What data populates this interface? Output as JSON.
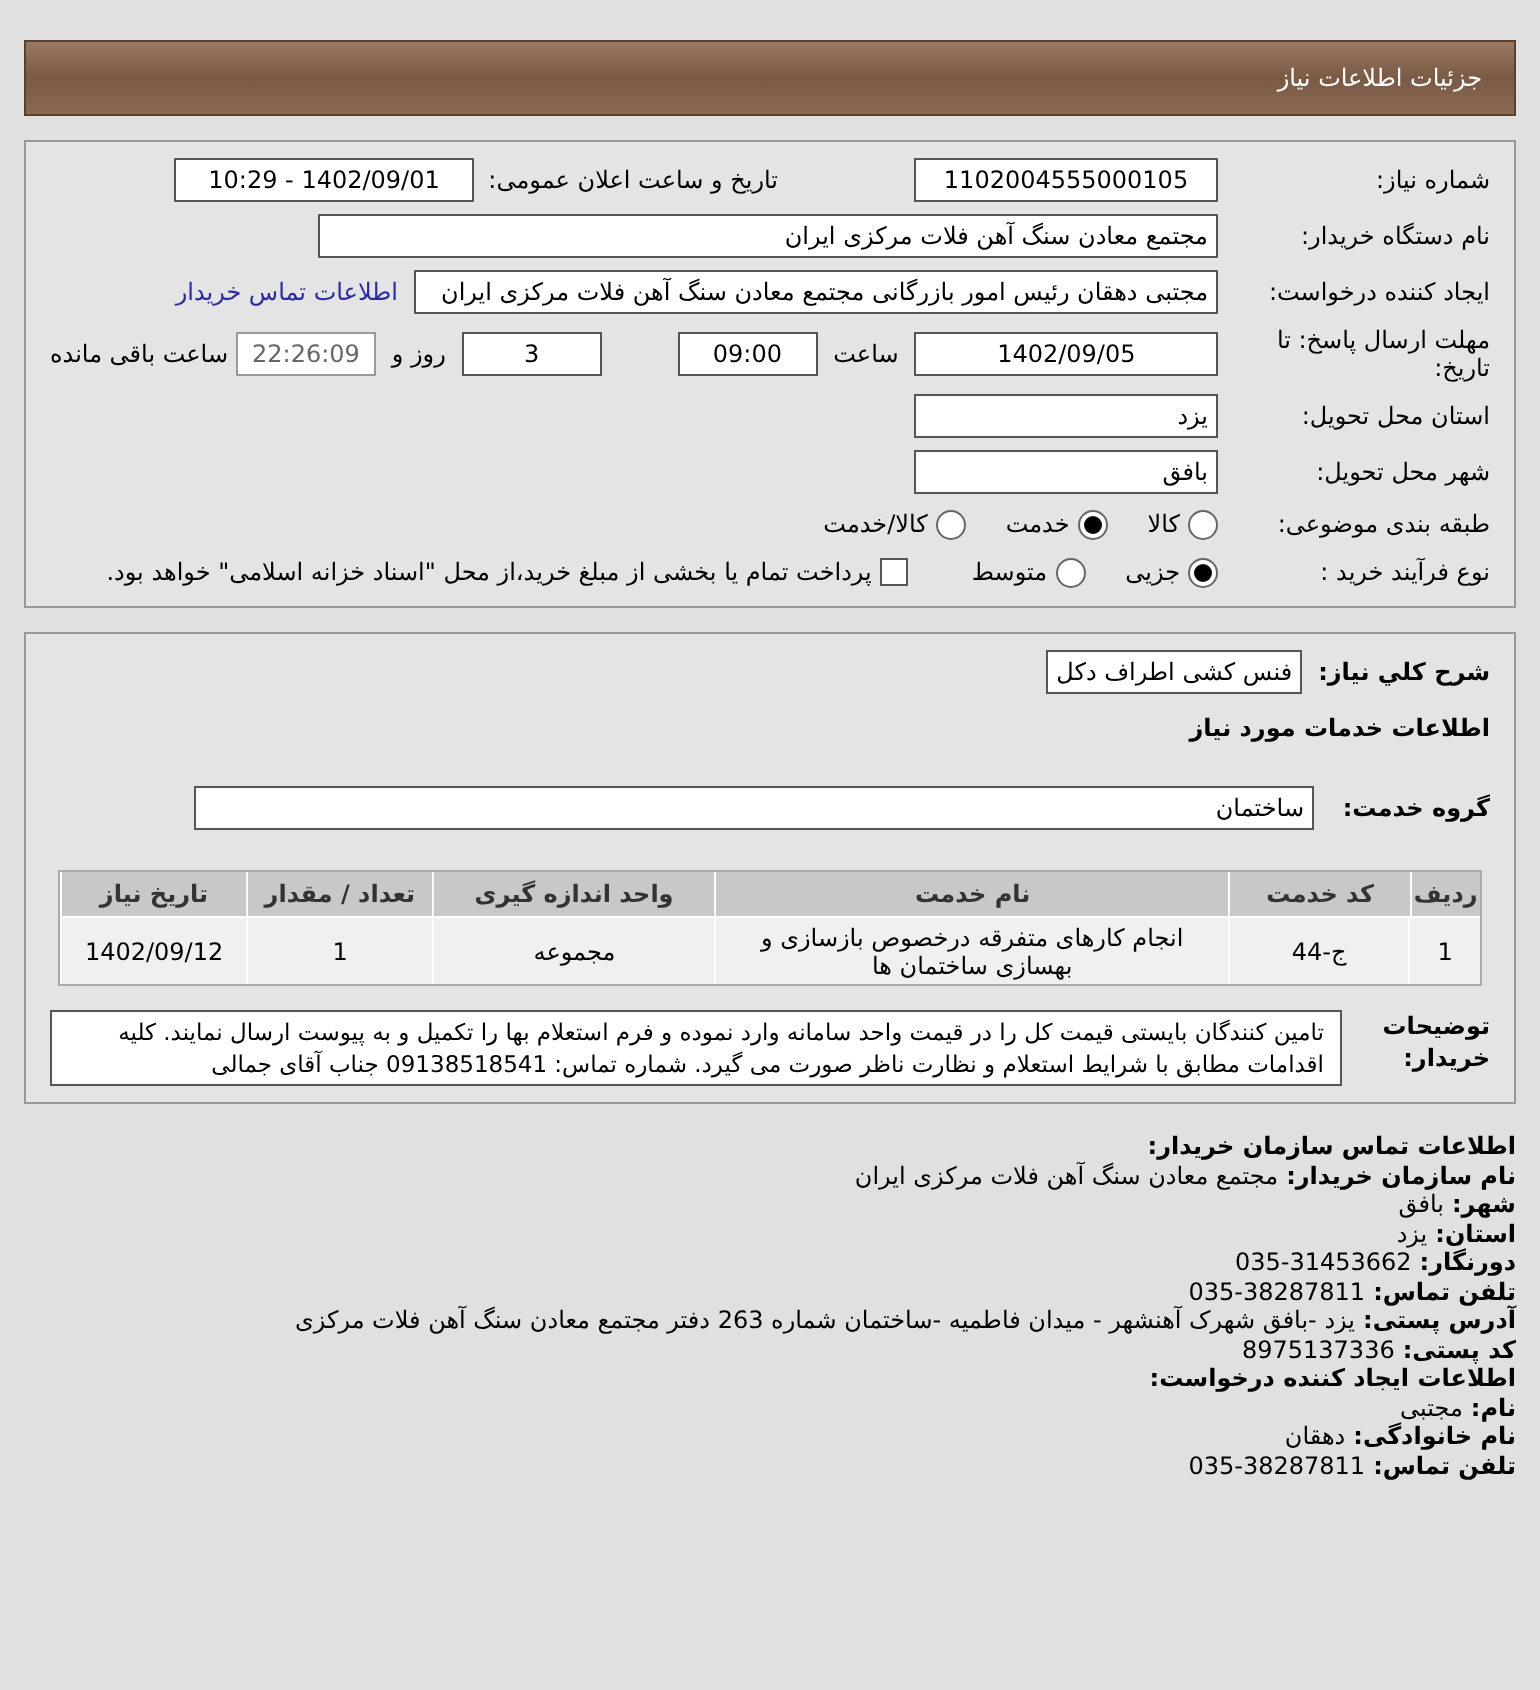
{
  "header": {
    "title": "جزئیات اطلاعات نیاز"
  },
  "details": {
    "need_number": {
      "label": "شماره نیاز:",
      "value": "1102004555000105"
    },
    "announce": {
      "label": "تاریخ و ساعت اعلان عمومی:",
      "value": "1402/09/01 - 10:29"
    },
    "buyer": {
      "label": "نام دستگاه خریدار:",
      "value": "مجتمع معادن سنگ آهن فلات مرکزی ایران"
    },
    "creator": {
      "label": "ایجاد کننده درخواست:",
      "value": "مجتبی  دهقان رئیس امور بازرگانی مجتمع معادن سنگ آهن فلات مرکزی ایران",
      "link": "اطلاعات تماس خریدار"
    },
    "deadline": {
      "label": "مهلت ارسال پاسخ: تا تاریخ:",
      "date": "1402/09/05",
      "time_label": "ساعت",
      "time": "09:00",
      "days": "3",
      "days_label": "روز و",
      "remaining": "22:26:09",
      "remaining_label": "ساعت باقی مانده"
    },
    "province": {
      "label": "استان محل تحویل:",
      "value": "یزد"
    },
    "city": {
      "label": "شهر محل تحویل:",
      "value": "بافق"
    },
    "category": {
      "label": "طبقه بندی موضوعی:",
      "options": [
        {
          "label": "کالا",
          "selected": false
        },
        {
          "label": "خدمت",
          "selected": true
        },
        {
          "label": "کالا/خدمت",
          "selected": false
        }
      ]
    },
    "process": {
      "label": "نوع فرآیند خرید :",
      "options": [
        {
          "label": "جزیی",
          "selected": true
        },
        {
          "label": "متوسط",
          "selected": false
        }
      ],
      "payment": {
        "checked": false,
        "label": "پرداخت تمام یا بخشی از مبلغ خرید،از محل \"اسناد خزانه اسلامی\" خواهد بود."
      }
    }
  },
  "summary": {
    "description": {
      "label": "شرح کلي نیاز:",
      "value": "فنس کشی اطراف دکل"
    },
    "section_title": "اطلاعات خدمات مورد نیاز",
    "service_group": {
      "label": "گروه خدمت:",
      "value": "ساختمان"
    },
    "table": {
      "columns": [
        "ردیف",
        "کد خدمت",
        "نام خدمت",
        "واحد اندازه گیری",
        "تعداد / مقدار",
        "تاریخ نیاز"
      ],
      "rows": [
        [
          "1",
          "ج-44",
          "انجام کارهای متفرقه درخصوص بازسازی و بهسازی ساختمان ها",
          "مجموعه",
          "1",
          "1402/09/12"
        ]
      ]
    },
    "notes": {
      "label": "توضیحات خریدار:",
      "value": "تامین کنندگان بایستی قیمت کل را در قیمت واحد سامانه وارد نموده و فرم استعلام بها را تکمیل و به پیوست ارسال نمایند. کلیه اقدامات مطابق با شرایط استعلام و نظارت ناظر صورت می گیرد. شماره تماس: 09138518541 جناب آقای جمالی"
    }
  },
  "contact": [
    {
      "kind": "heading",
      "label": "اطلاعات تماس سازمان خریدار:"
    },
    {
      "kind": "field",
      "label": "نام سازمان خریدار:",
      "value": "مجتمع معادن سنگ آهن فلات مرکزی ایران"
    },
    {
      "kind": "field",
      "label": "شهر:",
      "value": "بافق"
    },
    {
      "kind": "field",
      "label": "استان:",
      "value": "یزد"
    },
    {
      "kind": "field",
      "label": "دورنگار:",
      "value": "035-31453662"
    },
    {
      "kind": "field",
      "label": "تلفن تماس:",
      "value": "035-38287811"
    },
    {
      "kind": "field",
      "label": "آدرس پستی:",
      "value": "یزد -بافق شهرک آهنشهر - میدان فاطمیه -ساختمان شماره 263 دفتر مجتمع معادن سنگ آهن فلات مرکزی"
    },
    {
      "kind": "field",
      "label": "کد پستی:",
      "value": "8975137336"
    },
    {
      "kind": "heading",
      "label": "اطلاعات ایجاد کننده درخواست:"
    },
    {
      "kind": "field",
      "label": "نام:",
      "value": "مجتبی"
    },
    {
      "kind": "field",
      "label": "نام خانوادگی:",
      "value": "دهقان"
    },
    {
      "kind": "field",
      "label": "تلفن تماس:",
      "value": "035-38287811"
    }
  ]
}
